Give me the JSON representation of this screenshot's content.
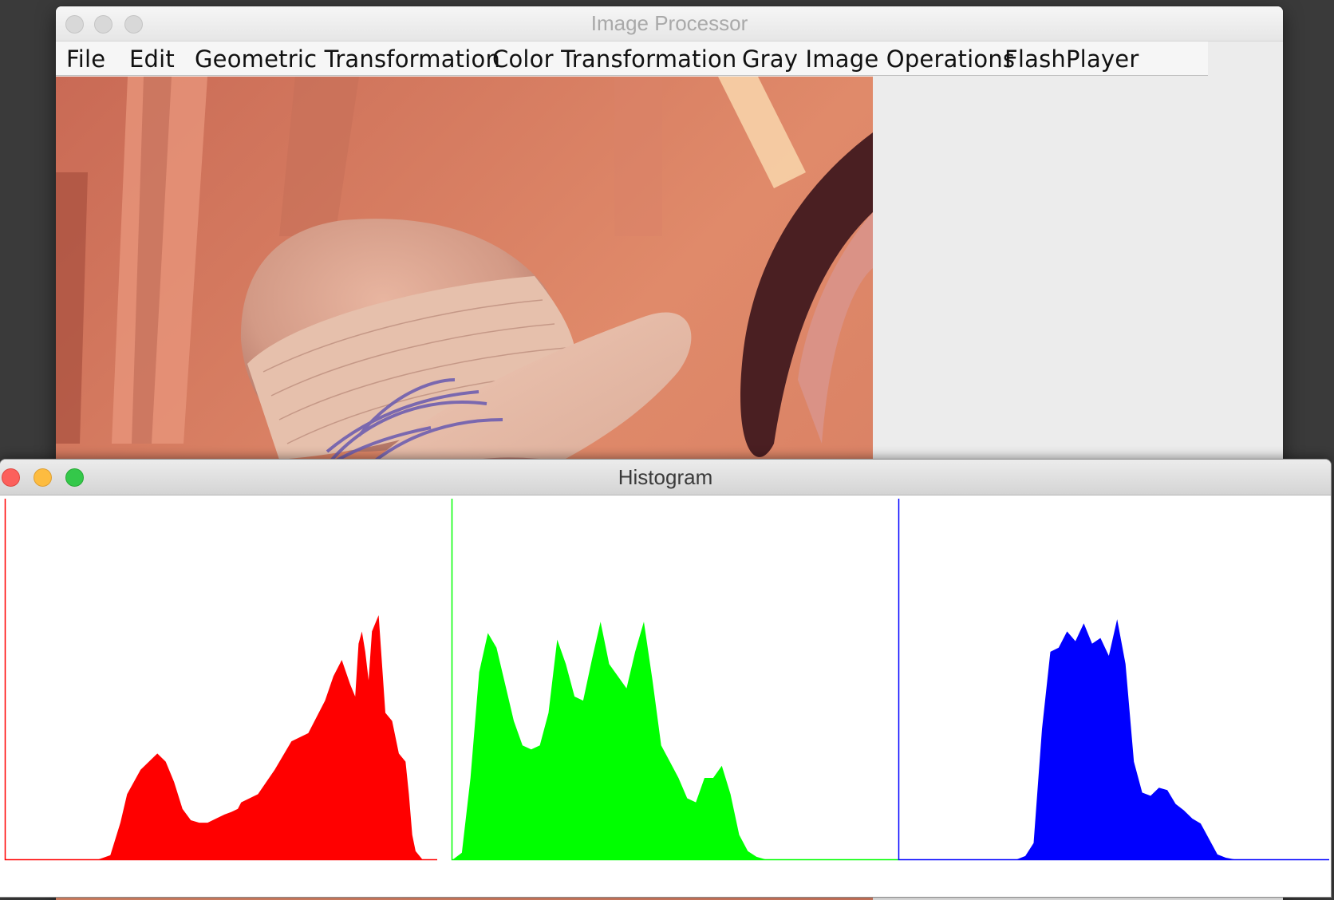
{
  "main_window": {
    "title": "Image Processor",
    "menu": [
      "File",
      "Edit",
      "Geometric Transformation",
      "Color Transformation",
      "Gray Image Operations",
      "FlashPlayer"
    ]
  },
  "histogram_window": {
    "title": "Histogram"
  },
  "colors": {
    "red_channel": "#ff0000",
    "green_channel": "#00ff00",
    "blue_channel": "#0000ff"
  },
  "chart_data": {
    "type": "area",
    "title": "",
    "xlim": [
      0,
      255
    ],
    "series": [
      {
        "name": "",
        "color": "#ff0000",
        "bins": [
          0,
          30,
          55,
          62,
          68,
          72,
          80,
          90,
          95,
          100,
          105,
          110,
          115,
          120,
          125,
          130,
          134,
          138,
          140,
          145,
          150,
          160,
          170,
          180,
          190,
          195,
          200,
          205,
          208,
          210,
          212,
          214,
          216,
          218,
          222,
          226,
          230,
          234,
          238,
          240,
          242,
          244,
          246,
          248,
          250,
          255
        ],
        "values": [
          0,
          0,
          0,
          5,
          45,
          80,
          110,
          130,
          120,
          95,
          62,
          48,
          45,
          45,
          50,
          55,
          58,
          62,
          70,
          75,
          80,
          110,
          145,
          155,
          195,
          225,
          245,
          215,
          200,
          265,
          280,
          255,
          220,
          280,
          300,
          180,
          170,
          130,
          120,
          80,
          30,
          10,
          5,
          0,
          0,
          0
        ]
      },
      {
        "name": "",
        "color": "#00ff00",
        "bins": [
          0,
          5,
          10,
          15,
          20,
          25,
          30,
          35,
          40,
          45,
          50,
          55,
          60,
          65,
          70,
          75,
          80,
          85,
          90,
          95,
          100,
          105,
          110,
          115,
          120,
          125,
          130,
          135,
          140,
          145,
          150,
          155,
          160,
          165,
          170,
          175,
          180,
          185,
          190,
          195,
          200,
          205,
          210,
          215,
          220,
          225,
          230,
          235,
          240,
          245,
          250,
          255
        ],
        "values": [
          0,
          8,
          100,
          230,
          278,
          260,
          215,
          170,
          140,
          135,
          140,
          180,
          270,
          240,
          200,
          195,
          245,
          292,
          240,
          225,
          210,
          255,
          292,
          220,
          140,
          120,
          100,
          75,
          70,
          100,
          100,
          115,
          80,
          30,
          10,
          3,
          0,
          0,
          0,
          0,
          0,
          0,
          0,
          0,
          0,
          0,
          0,
          0,
          0,
          0,
          0,
          0
        ]
      },
      {
        "name": "",
        "color": "#0000ff",
        "bins": [
          0,
          5,
          10,
          15,
          20,
          25,
          30,
          35,
          40,
          45,
          50,
          55,
          60,
          65,
          70,
          75,
          80,
          85,
          90,
          95,
          100,
          105,
          110,
          115,
          120,
          125,
          130,
          135,
          140,
          145,
          150,
          155,
          160,
          165,
          170,
          175,
          180,
          185,
          190,
          195,
          200,
          205,
          210,
          215,
          220,
          225,
          230,
          235,
          240,
          245,
          250,
          255
        ],
        "values": [
          0,
          0,
          0,
          0,
          0,
          0,
          0,
          0,
          0,
          0,
          0,
          0,
          0,
          0,
          0,
          4,
          20,
          160,
          255,
          260,
          280,
          268,
          290,
          265,
          272,
          250,
          295,
          240,
          120,
          82,
          78,
          88,
          85,
          68,
          60,
          50,
          44,
          25,
          6,
          2,
          0,
          0,
          0,
          0,
          0,
          0,
          0,
          0,
          0,
          0,
          0,
          0
        ]
      }
    ]
  }
}
